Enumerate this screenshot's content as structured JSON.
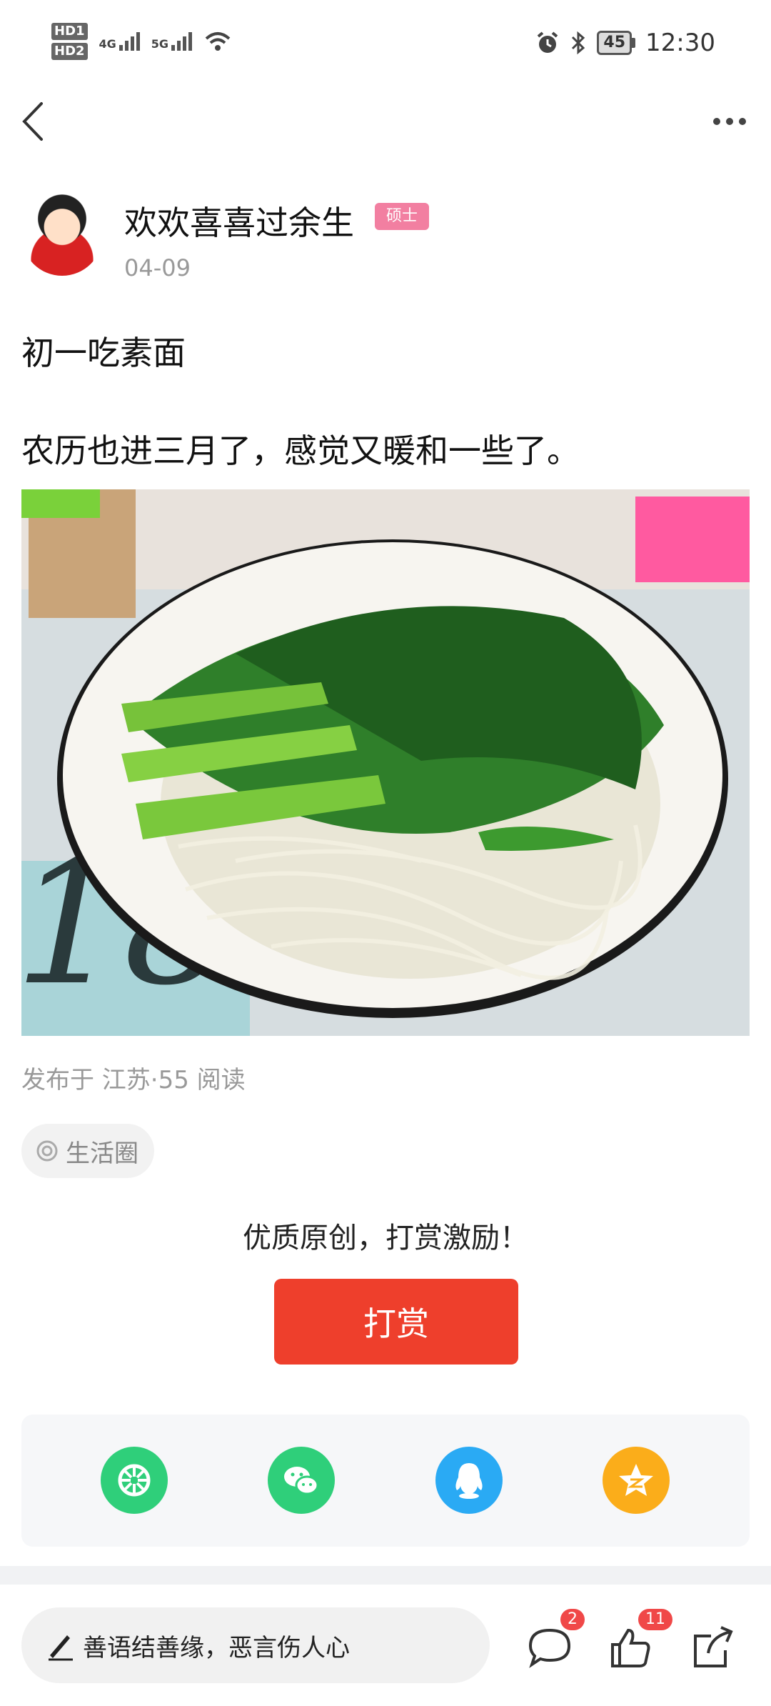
{
  "status_bar": {
    "hd1": "HD1",
    "hd2": "HD2",
    "net1": "4G",
    "net2": "5G",
    "battery": "45",
    "time": "12:30"
  },
  "nav": {
    "back_icon": "chevron-left-icon",
    "more_icon": "more-dots-icon"
  },
  "author": {
    "name": "欢欢喜喜过余生",
    "badge": "硕士",
    "date": "04-09"
  },
  "post": {
    "title": "初一吃素面",
    "body": "农历也进三月了，感觉又暖和一些了。",
    "meta": "发布于 江苏·55 阅读",
    "topic": "生活圈"
  },
  "reward": {
    "prompt": "优质原创，打赏激励！",
    "button": "打赏"
  },
  "share": {
    "items": [
      {
        "icon": "moments-icon",
        "color": "#2fcf7a"
      },
      {
        "icon": "wechat-icon",
        "color": "#2fcf7a"
      },
      {
        "icon": "qq-icon",
        "color": "#2aaaf4"
      },
      {
        "icon": "qzone-icon",
        "color": "#fbad1a"
      }
    ]
  },
  "bottom_bar": {
    "comment_placeholder": "善语结善缘，恶言伤人心",
    "comment_count": "2",
    "like_count": "11"
  },
  "colors": {
    "accent_red": "#ee3f2c",
    "badge_pink": "#f27fa1"
  }
}
